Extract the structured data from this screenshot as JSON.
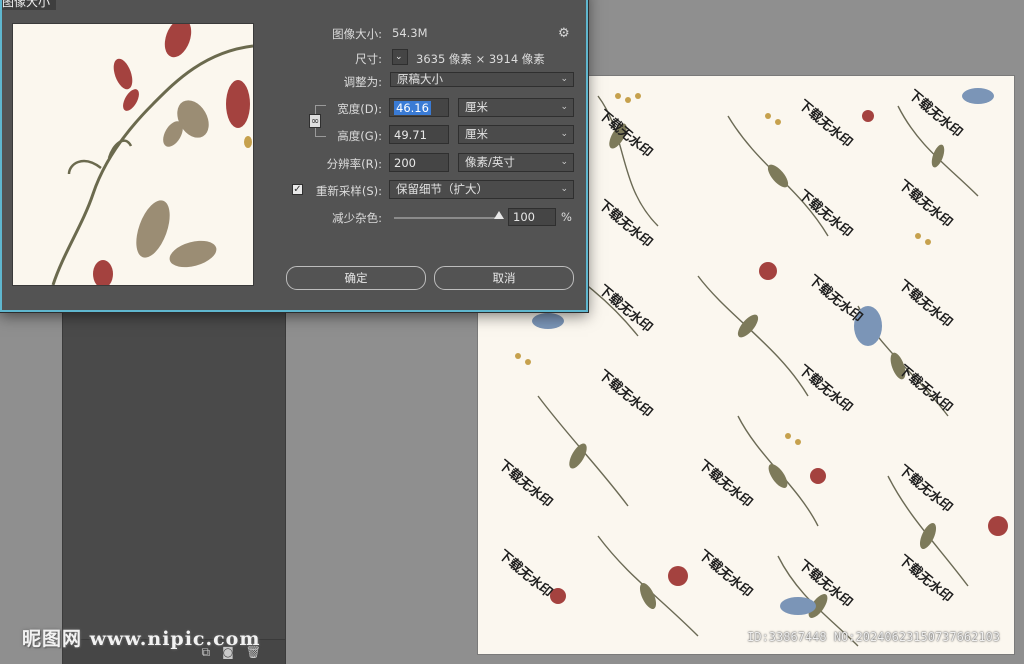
{
  "dialog": {
    "title": "图像大小",
    "image_size_label": "图像大小:",
    "image_size_value": "54.3M",
    "dimensions_label": "尺寸:",
    "dimensions_value": "3635 像素 × 3914 像素",
    "fit_to_label": "调整为:",
    "fit_to_value": "原稿大小",
    "width_label": "宽度(D):",
    "width_value": "46.16",
    "width_unit": "厘米",
    "height_label": "高度(G):",
    "height_value": "49.71",
    "height_unit": "厘米",
    "resolution_label": "分辨率(R):",
    "resolution_value": "200",
    "resolution_unit": "像素/英寸",
    "resample_label": "重新采样(S):",
    "resample_checked": true,
    "resample_value": "保留细节（扩大）",
    "reduce_noise_label": "减少杂色:",
    "reduce_noise_value": "100",
    "reduce_noise_unit": "%",
    "ok_label": "确定",
    "cancel_label": "取消",
    "icons": {
      "settings": "gear-icon",
      "dimensions_toggle": "chevron-down-icon",
      "constrain": "chain-link-icon"
    }
  },
  "canvas": {
    "watermark_text": "下载无水印",
    "id_text": "ID:33867448 NO:20240623150737662103"
  },
  "site_watermark": "昵图网 www.nipic.com",
  "panel": {
    "icons": [
      "new-layer-icon",
      "camera-icon",
      "trash-icon"
    ]
  },
  "colors": {
    "dialog_bg": "#535353",
    "dialog_border": "#5fb7cf",
    "canvas_bg": "#fbf7ef",
    "selection": "#3a7bd5"
  }
}
